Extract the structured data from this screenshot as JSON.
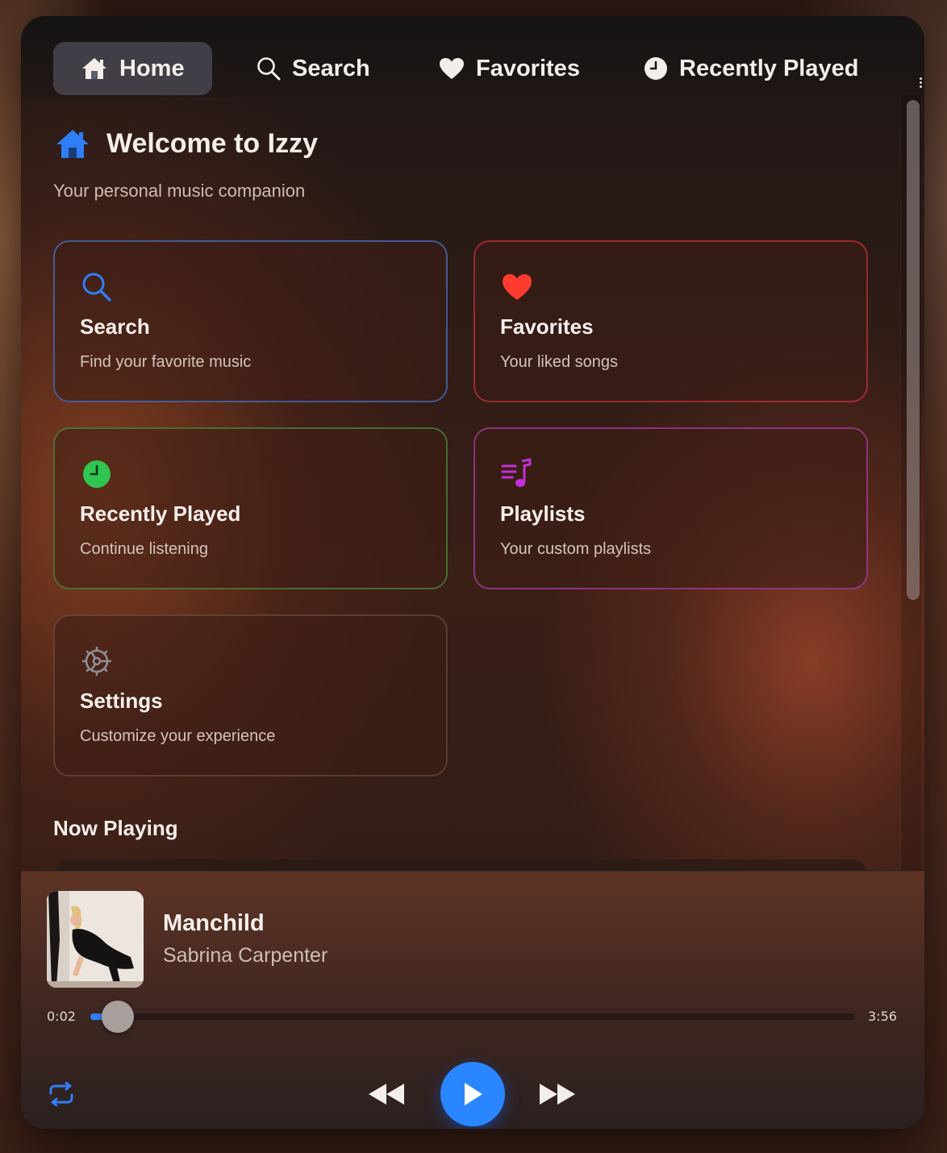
{
  "tabs": [
    {
      "label": "Home",
      "icon": "home-icon",
      "active": true
    },
    {
      "label": "Search",
      "icon": "search-icon",
      "active": false
    },
    {
      "label": "Favorites",
      "icon": "heart-icon",
      "active": false
    },
    {
      "label": "Recently Played",
      "icon": "clock-icon",
      "active": false
    }
  ],
  "welcome": {
    "title": "Welcome to Izzy",
    "subtitle": "Your personal music companion"
  },
  "cards": [
    {
      "title": "Search",
      "desc": "Find your favorite music",
      "icon": "search-icon",
      "color": "#2f7ef6"
    },
    {
      "title": "Favorites",
      "desc": "Your liked songs",
      "icon": "heart-icon",
      "color": "#ff3b30"
    },
    {
      "title": "Recently Played",
      "desc": "Continue listening",
      "icon": "clock-icon",
      "color": "#30c551"
    },
    {
      "title": "Playlists",
      "desc": "Your custom playlists",
      "icon": "music-list-icon",
      "color": "#c430d8"
    },
    {
      "title": "Settings",
      "desc": "Customize your experience",
      "icon": "gear-icon",
      "color": "#8e8e93"
    }
  ],
  "now_playing": {
    "heading": "Now Playing"
  },
  "player": {
    "title": "Manchild",
    "artist": "Sabrina Carpenter",
    "current_time": "0:02",
    "duration": "3:56",
    "progress_fraction": 0.0085,
    "accent": "#2a86ff"
  }
}
